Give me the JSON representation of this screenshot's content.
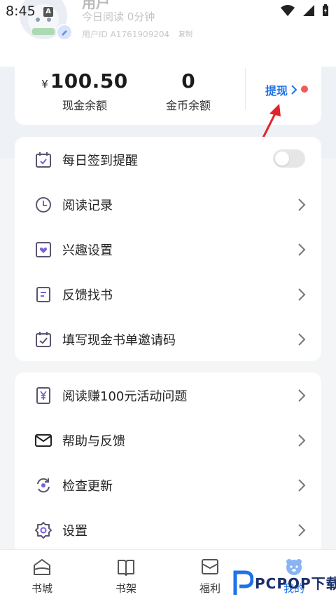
{
  "status_bar": {
    "time": "8:45",
    "notification_letter": "A"
  },
  "profile": {
    "name_fragment": "用户",
    "read_today": "今日阅读 0分钟",
    "user_id": "用户ID A1761909204",
    "copy_label": "复制"
  },
  "balance": {
    "currency_symbol": "¥",
    "cash_value": "100.50",
    "cash_label": "现金余额",
    "coin_value": "0",
    "coin_label": "金币余额",
    "withdraw_label": "提现"
  },
  "menu_group1": [
    {
      "label": "每日签到提醒",
      "icon": "calendar-icon"
    },
    {
      "label": "阅读记录",
      "icon": "clock-icon"
    },
    {
      "label": "兴趣设置",
      "icon": "heart-icon"
    },
    {
      "label": "反馈找书",
      "icon": "book-icon"
    },
    {
      "label": "填写现金书单邀请码",
      "icon": "calendar-check-icon"
    }
  ],
  "menu_group2": [
    {
      "label": "阅读赚100元活动问题",
      "icon": "yen-icon"
    },
    {
      "label": "帮助与反馈",
      "icon": "mail-icon"
    },
    {
      "label": "检查更新",
      "icon": "refresh-icon"
    },
    {
      "label": "设置",
      "icon": "gear-icon"
    }
  ],
  "daily_reminder_enabled": false,
  "tabs": [
    {
      "label": "书城",
      "icon": "home-icon"
    },
    {
      "label": "书架",
      "icon": "bookshelf-icon"
    },
    {
      "label": "福利",
      "icon": "gift-icon"
    },
    {
      "label": "我的",
      "icon": "bear-icon",
      "active": true
    }
  ],
  "watermark": {
    "text": "PCPOP下载"
  },
  "colors": {
    "accent": "#1e72e8",
    "dot": "#f25a5a",
    "icon_stroke": "#5c5470"
  }
}
